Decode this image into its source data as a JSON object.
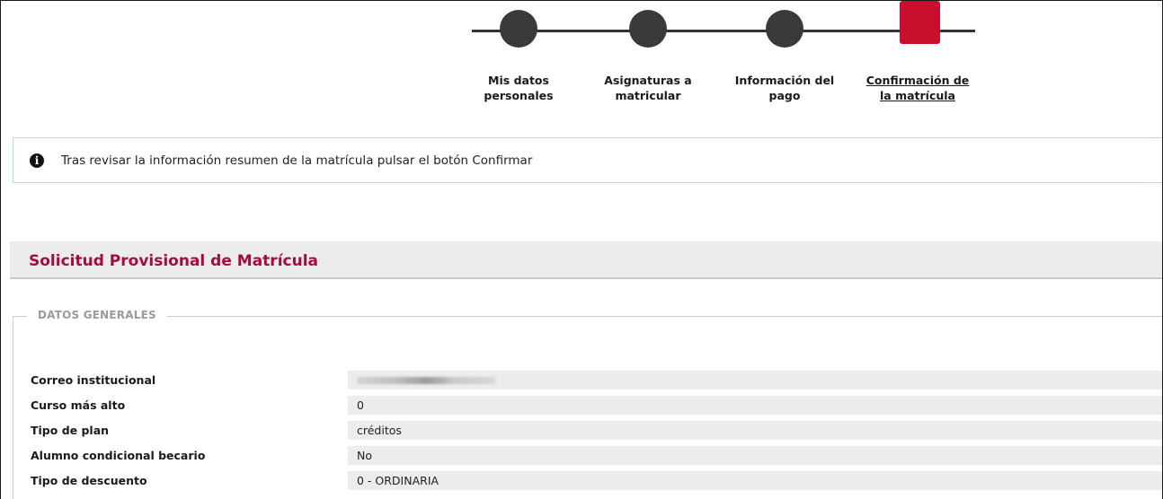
{
  "stepper": {
    "steps": [
      {
        "label": "Mis datos\npersonales",
        "active": false
      },
      {
        "label": "Asignaturas a\nmatricular",
        "active": false
      },
      {
        "label": "Información del\npago",
        "active": false
      },
      {
        "label": "Confirmación de\nla matrícula",
        "active": true
      }
    ]
  },
  "alert": {
    "icon": "info-icon",
    "text": "Tras revisar la información resumen de la matrícula pulsar el botón Confirmar"
  },
  "section": {
    "title": "Solicitud Provisional de Matrícula",
    "legend": "DATOS GENERALES"
  },
  "fields": [
    {
      "label": "Correo institucional",
      "value": ""
    },
    {
      "label": "Curso más alto",
      "value": "0"
    },
    {
      "label": "Tipo de plan",
      "value": "créditos"
    },
    {
      "label": "Alumno condicional becario",
      "value": "No"
    },
    {
      "label": "Tipo de descuento",
      "value": "0 - ORDINARIA"
    }
  ],
  "colors": {
    "accent": "#c8102e",
    "title": "#a40d3a",
    "alert_border": "#9ee5e8",
    "step_marker": "#3a3a3a"
  }
}
